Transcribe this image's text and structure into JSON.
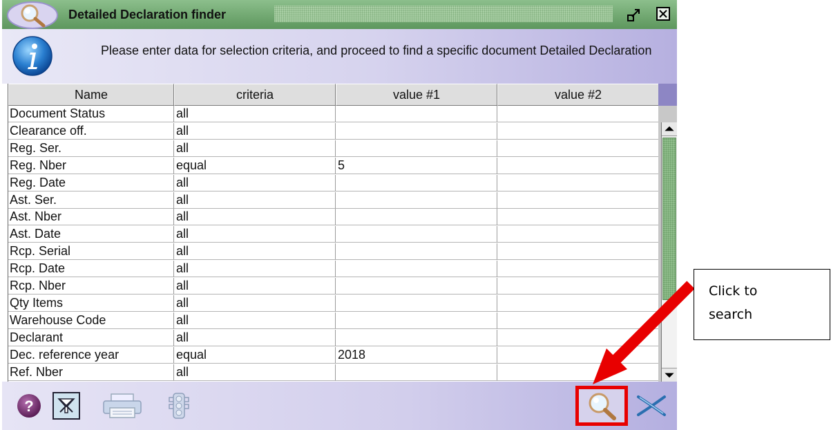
{
  "window": {
    "title": "Detailed Declaration finder",
    "info_text": "Please enter data for selection criteria, and proceed to find a specific document Detailed Declaration"
  },
  "table": {
    "headers": [
      "Name",
      "criteria",
      "value #1",
      "value #2"
    ],
    "rows": [
      [
        "Document Status",
        "all",
        "",
        ""
      ],
      [
        "Clearance off.",
        "all",
        "",
        ""
      ],
      [
        "Reg. Ser.",
        "all",
        "",
        ""
      ],
      [
        "Reg. Nber",
        "equal",
        "5",
        ""
      ],
      [
        "Reg. Date",
        "all",
        "",
        ""
      ],
      [
        "Ast. Ser.",
        "all",
        "",
        ""
      ],
      [
        "Ast. Nber",
        "all",
        "",
        ""
      ],
      [
        "Ast. Date",
        "all",
        "",
        ""
      ],
      [
        "Rcp. Serial",
        "all",
        "",
        ""
      ],
      [
        "Rcp. Date",
        "all",
        "",
        ""
      ],
      [
        "Rcp. Nber",
        "all",
        "",
        ""
      ],
      [
        "Qty Items",
        "all",
        "",
        ""
      ],
      [
        "Warehouse Code",
        "all",
        "",
        ""
      ],
      [
        "Declarant",
        "all",
        "",
        ""
      ],
      [
        "Dec. reference year",
        "equal",
        "2018",
        ""
      ],
      [
        "Ref. Nber",
        "all",
        "",
        ""
      ]
    ]
  },
  "toolbar": {
    "icons": [
      "help-icon",
      "clear-filter-icon",
      "printer-icon",
      "traffic-light-icon",
      "search-magnifier-icon",
      "close-x-icon"
    ]
  },
  "annotation": {
    "line1": "Click to",
    "line2": "search",
    "highlight_color": "#e80000"
  },
  "colors": {
    "titlebar": "#6fa66f",
    "panel": "#d6d3ee",
    "scroll_thumb": "#8fbd8b"
  }
}
